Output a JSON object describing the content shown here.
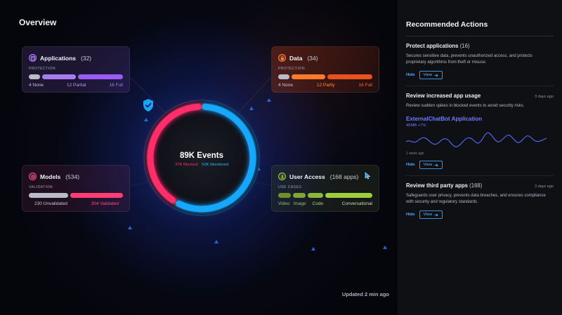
{
  "overview": {
    "title": "Overview",
    "updated": "Updated 2 min ago"
  },
  "cards": {
    "applications": {
      "title": "Applications",
      "count": "(32)",
      "sub": "PROTECTION",
      "legend": [
        "4 None",
        "12 Partial",
        "16 Full"
      ],
      "values": [
        4,
        12,
        16
      ]
    },
    "data": {
      "title": "Data",
      "count": "(34)",
      "sub": "PROTECTION",
      "legend": [
        "4 None",
        "12 Partly",
        "16 Full"
      ],
      "values": [
        4,
        12,
        16
      ]
    },
    "models": {
      "title": "Models",
      "count": "(534)",
      "sub": "VALIDATION",
      "legend": [
        "230 Unvalidated",
        "304 Validated"
      ],
      "values": [
        230,
        304
      ]
    },
    "users": {
      "title": "User Access",
      "count": "(168 apps)",
      "sub": "USE CASES",
      "legend": [
        "Video",
        "Image",
        "Code",
        "Conversational"
      ]
    }
  },
  "events": {
    "total": "89K Events",
    "blocked": "37K Blocked",
    "monitored": "52K Monitored",
    "blocked_value": 37,
    "monitored_value": 52
  },
  "colors": {
    "blocked": "#ff2d6b",
    "monitored": "#12a8ff",
    "accent_blue": "#4fa3ff",
    "chart_purple": "#6d7cff"
  },
  "panel": {
    "title": "Recommended Actions",
    "actions": [
      {
        "title": "Protect applications",
        "count": "(16)",
        "time": "",
        "desc": "Secures sensitive data, prevents unauthorized access, and protects proprietary algorithms from theft or misuse.",
        "hide": "Hide",
        "view": "View"
      },
      {
        "title": "Review increased app usage",
        "count": "",
        "time": "3 days ago",
        "desc": "Review sudden spikes in blocked events to avoid security risks.",
        "chart_title": "ExternalChatBot Application",
        "chart_sub": "45MB +7%",
        "chart_axis": "1 week ago",
        "hide": "Hide",
        "view": "View"
      },
      {
        "title": "Review third party apps",
        "count": "(168)",
        "time": "3 days ago",
        "desc": "Safeguards user privacy, prevents data breaches, and ensures compliance with security and regulatory standards.",
        "hide": "Hide",
        "view": "View"
      }
    ]
  },
  "icons": {
    "applications": "app-window-icon",
    "data": "lock-icon",
    "models": "model-icon",
    "users": "users-icon",
    "shield": "shield-check-icon",
    "arrow": "arrow-right-icon",
    "cursor": "pointer-cursor-icon"
  }
}
